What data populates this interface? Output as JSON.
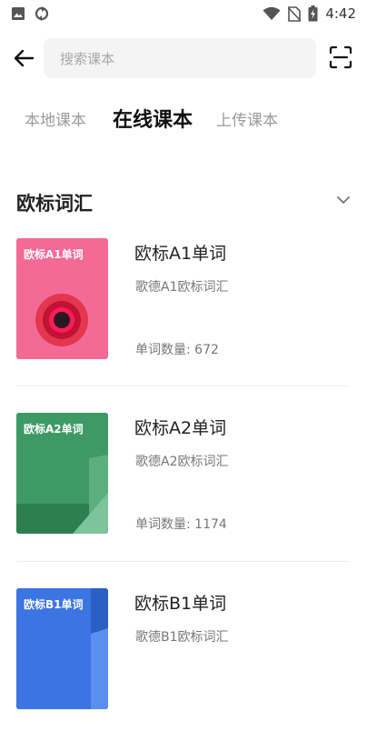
{
  "status_bar": {
    "time": "4:42"
  },
  "search": {
    "placeholder": "搜索课本",
    "value": ""
  },
  "tabs": [
    {
      "label": "本地课本",
      "active": false
    },
    {
      "label": "在线课本",
      "active": true
    },
    {
      "label": "上传课本",
      "active": false
    }
  ],
  "section": {
    "title": "欧标词汇"
  },
  "books": [
    {
      "cover_label": "欧标A1单词",
      "title": "欧标A1单词",
      "subtitle": "歌德A1欧标词汇",
      "count": "单词数量: 672",
      "cover_color": "#f46a97"
    },
    {
      "cover_label": "欧标A2单词",
      "title": "欧标A2单词",
      "subtitle": "歌德A2欧标词汇",
      "count": "单词数量: 1174",
      "cover_color": "#3e9a64"
    },
    {
      "cover_label": "欧标B1单词",
      "title": "欧标B1单词",
      "subtitle": "歌德B1欧标词汇",
      "count": "",
      "cover_color": "#3b74e3"
    }
  ]
}
